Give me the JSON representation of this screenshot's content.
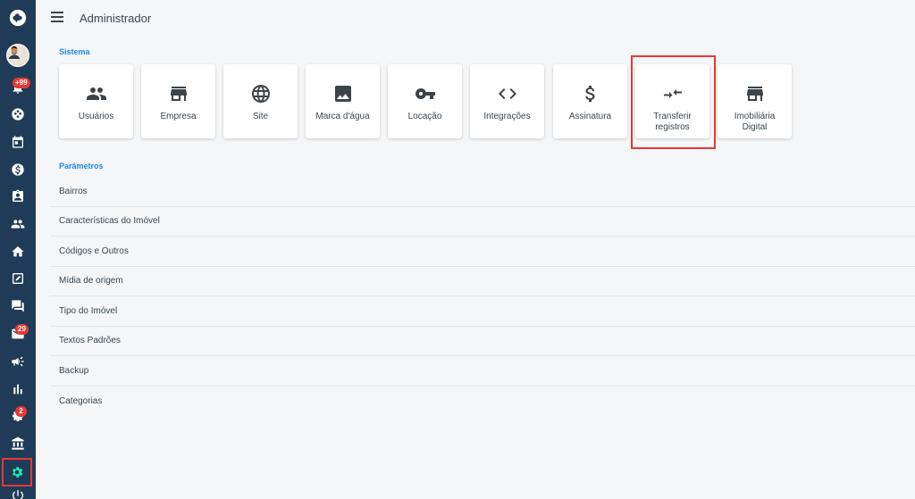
{
  "header": {
    "title": "Administrador"
  },
  "sidebar": {
    "badges": {
      "notifications": "+99",
      "mail": "29",
      "settings_group": "2"
    }
  },
  "sections": {
    "system": "Sistema",
    "params": "Parâmetros"
  },
  "cards": [
    {
      "label": "Usuários",
      "icon": "users-icon"
    },
    {
      "label": "Empresa",
      "icon": "store-icon"
    },
    {
      "label": "Site",
      "icon": "globe-icon"
    },
    {
      "label": "Marca d'água",
      "icon": "image-icon"
    },
    {
      "label": "Locação",
      "icon": "key-icon"
    },
    {
      "label": "Integrações",
      "icon": "code-icon"
    },
    {
      "label": "Assinatura",
      "icon": "dollar-icon"
    },
    {
      "label": "Transferir registros",
      "icon": "transfer-icon"
    },
    {
      "label": "Imobiliária Digital",
      "icon": "storefront-icon"
    }
  ],
  "params": [
    "Bairros",
    "Características do Imóvel",
    "Códigos e Outros",
    "Mídia de origem",
    "Tipo do Imóvel",
    "Textos Padrões",
    "Backup",
    "Categorias"
  ],
  "colors": {
    "sidebar": "#1f3b57",
    "accent": "#1e88e5",
    "active_icon": "#1de9b6",
    "highlight": "#e53935"
  }
}
